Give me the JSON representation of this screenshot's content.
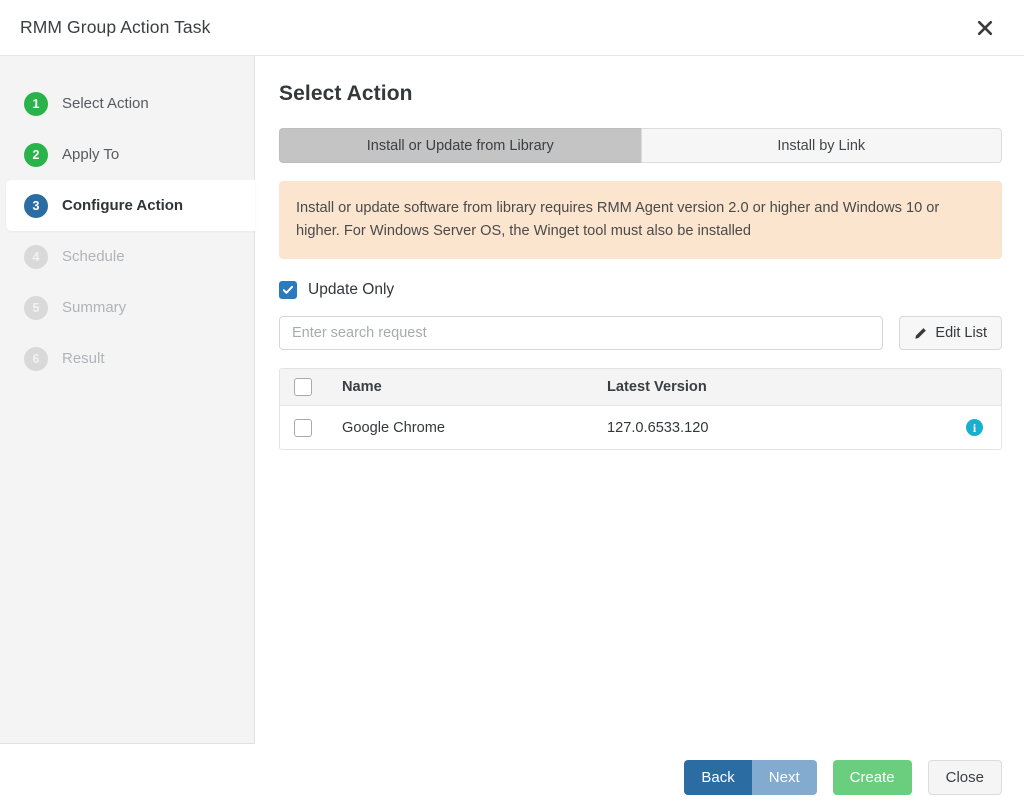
{
  "header": {
    "title": "RMM Group Action Task",
    "close_icon": "close-icon"
  },
  "sidebar": {
    "steps": [
      {
        "num": "1",
        "label": "Select Action",
        "state": "done"
      },
      {
        "num": "2",
        "label": "Apply To",
        "state": "done"
      },
      {
        "num": "3",
        "label": "Configure Action",
        "state": "active"
      },
      {
        "num": "4",
        "label": "Schedule",
        "state": "todo"
      },
      {
        "num": "5",
        "label": "Summary",
        "state": "todo"
      },
      {
        "num": "6",
        "label": "Result",
        "state": "todo"
      }
    ]
  },
  "main": {
    "title": "Select Action",
    "tabs": [
      {
        "label": "Install or Update from Library",
        "active": true
      },
      {
        "label": "Install by Link",
        "active": false
      }
    ],
    "notice": "Install or update software from library requires RMM Agent version 2.0 or higher and Windows 10 or higher. For Windows Server OS, the Winget tool must also be installed",
    "update_only": {
      "label": "Update Only",
      "checked": true
    },
    "search": {
      "placeholder": "Enter search request",
      "value": ""
    },
    "edit_list_label": "Edit List",
    "edit_list_icon": "pencil-icon",
    "table": {
      "columns": [
        "Name",
        "Latest Version"
      ],
      "rows": [
        {
          "name": "Google Chrome",
          "latest_version": "127.0.6533.120",
          "checked": false,
          "info_icon": "info-icon",
          "info_glyph": "i"
        }
      ],
      "header_checked": false
    }
  },
  "footer": {
    "back_label": "Back",
    "next_label": "Next",
    "create_label": "Create",
    "close_label": "Close"
  },
  "colors": {
    "accent_blue": "#2b6ca3",
    "next_blue": "#83aacf",
    "green": "#2ab34a",
    "create_green": "#6bce7f",
    "notice_bg": "#fbe5cf",
    "info_cyan": "#18b0cd",
    "checkbox_blue": "#2b79bf",
    "tab_active_bg": "#c4c4c4"
  }
}
